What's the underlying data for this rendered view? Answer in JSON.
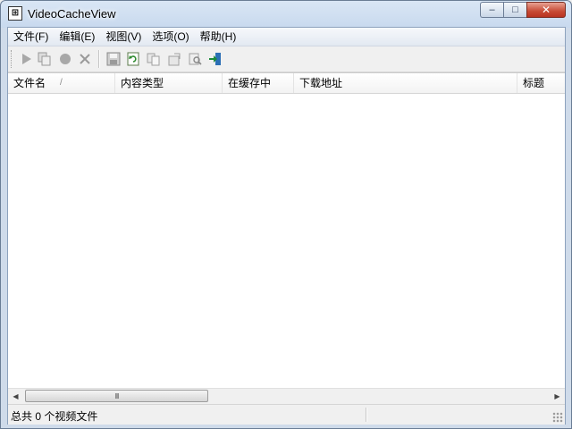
{
  "window": {
    "title": "VideoCacheView",
    "app_icon_glyph": "⊞",
    "min_glyph": "–",
    "max_glyph": "□",
    "close_glyph": "✕"
  },
  "menu": {
    "items": [
      {
        "label": "文件(F)"
      },
      {
        "label": "编辑(E)"
      },
      {
        "label": "视图(V)"
      },
      {
        "label": "选项(O)"
      },
      {
        "label": "帮助(H)"
      }
    ]
  },
  "toolbar": {
    "buttons": [
      "play-icon",
      "copy-files-icon",
      "stop-icon",
      "delete-icon",
      "save-icon",
      "refresh-icon",
      "copy-icon",
      "properties-icon",
      "find-icon",
      "exit-icon"
    ]
  },
  "list": {
    "columns": [
      {
        "label": "文件名"
      },
      {
        "label": "内容类型"
      },
      {
        "label": "在缓存中"
      },
      {
        "label": "下载地址"
      },
      {
        "label": "标题"
      }
    ],
    "sort_glyph": "/",
    "rows": []
  },
  "scrollbar": {
    "left_glyph": "◀",
    "right_glyph": "▶",
    "thumb_glyph": "III"
  },
  "status": {
    "text": "总共 0 个视频文件"
  }
}
